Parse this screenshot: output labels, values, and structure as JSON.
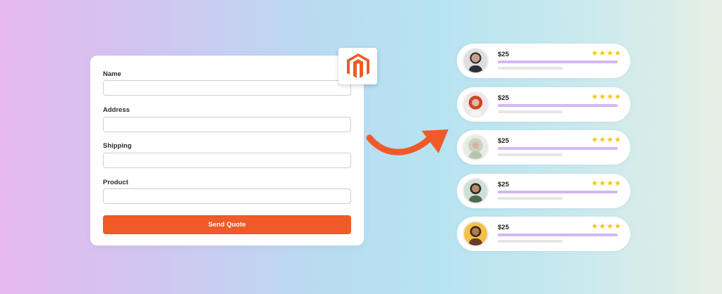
{
  "form": {
    "fields": [
      {
        "label": "Name",
        "value": "",
        "placeholder": ""
      },
      {
        "label": "Address",
        "value": "",
        "placeholder": ""
      },
      {
        "label": "Shipping",
        "value": "",
        "placeholder": ""
      },
      {
        "label": "Product",
        "value": "",
        "placeholder": ""
      }
    ],
    "submit_label": "Send Quote"
  },
  "logo": {
    "icon": "magento-logo",
    "color": "#f05a28"
  },
  "arrow": {
    "icon": "curved-arrow-icon",
    "color": "#f05a28"
  },
  "reviews": [
    {
      "price": "$25",
      "stars": "★★★★",
      "rating": 4,
      "avatar": "avatar-man-suit"
    },
    {
      "price": "$25",
      "stars": "★★★★",
      "rating": 4,
      "avatar": "avatar-woman-red-hair"
    },
    {
      "price": "$25",
      "stars": "★★★★",
      "rating": 4,
      "avatar": "avatar-woman-hijab"
    },
    {
      "price": "$25",
      "stars": "★★★★",
      "rating": 4,
      "avatar": "avatar-man-curly-hair"
    },
    {
      "price": "$25",
      "stars": "★★★★",
      "rating": 4,
      "avatar": "avatar-man-beard"
    }
  ],
  "colors": {
    "accent": "#f05a28",
    "star": "#f5c518",
    "bar": "#d5b6f5",
    "bar_sub": "#e6e6e6"
  }
}
